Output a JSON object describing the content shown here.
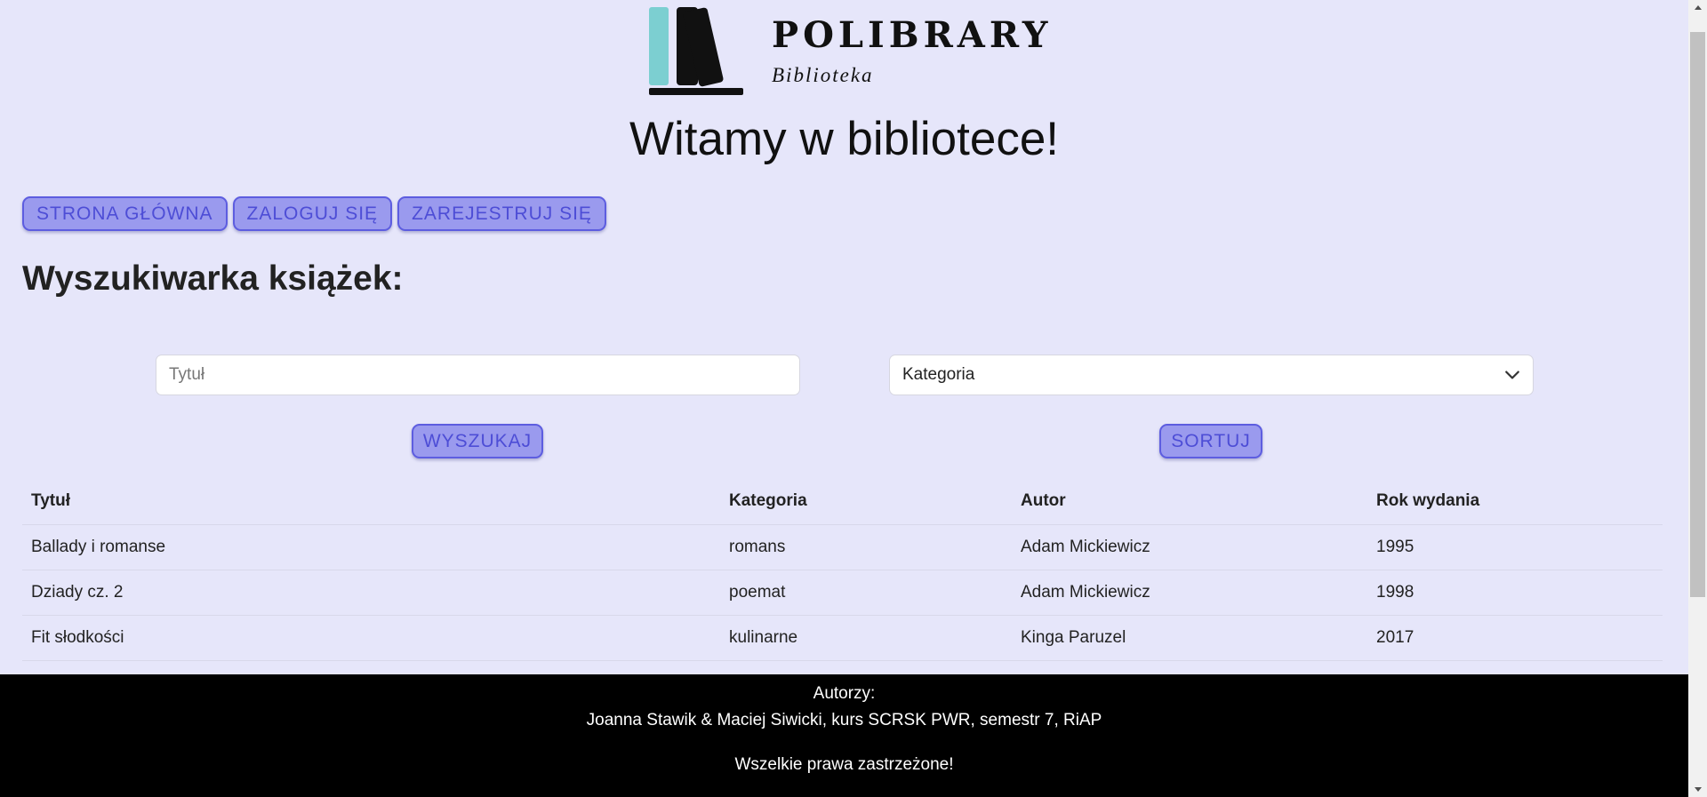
{
  "logo": {
    "title": "POLIBRARY",
    "subtitle": "Biblioteka",
    "colors": {
      "accent_book": "#7ccfd1",
      "dark": "#111111"
    }
  },
  "welcome": "Witamy w bibliotece!",
  "nav": {
    "home": "STRONA GŁÓWNA",
    "login": "ZALOGUJ SIĘ",
    "register": "ZAREJESTRUJ SIĘ"
  },
  "search": {
    "heading": "Wyszukiwarka książek:",
    "title_placeholder": "Tytuł",
    "title_value": "",
    "category_selected": "Kategoria",
    "search_button": "WYSZUKAJ",
    "sort_button": "SORTUJ"
  },
  "table": {
    "headers": [
      "Tytuł",
      "Kategoria",
      "Autor",
      "Rok wydania"
    ],
    "rows": [
      [
        "Ballady i romanse",
        "romans",
        "Adam Mickiewicz",
        "1995"
      ],
      [
        "Dziady cz. 2",
        "poemat",
        "Adam Mickiewicz",
        "1998"
      ],
      [
        "Fit słodkości",
        "kulinarne",
        "Kinga Paruzel",
        "2017"
      ]
    ]
  },
  "footer": {
    "authors_label": "Autorzy:",
    "authors_names": "Joanna Stawik & Maciej Siwicki, kurs SCRSK PWR, semestr 7, RiAP",
    "rights": "Wszelkie prawa zastrzeżone!"
  },
  "colors": {
    "background": "#e6e6fa",
    "button_fill": "#9a9aee",
    "button_border": "#5d5de0",
    "button_text": "#4d4dd6",
    "footer_bg": "#000000"
  },
  "icons": [
    "books-logo-icon",
    "chevron-down-icon"
  ]
}
